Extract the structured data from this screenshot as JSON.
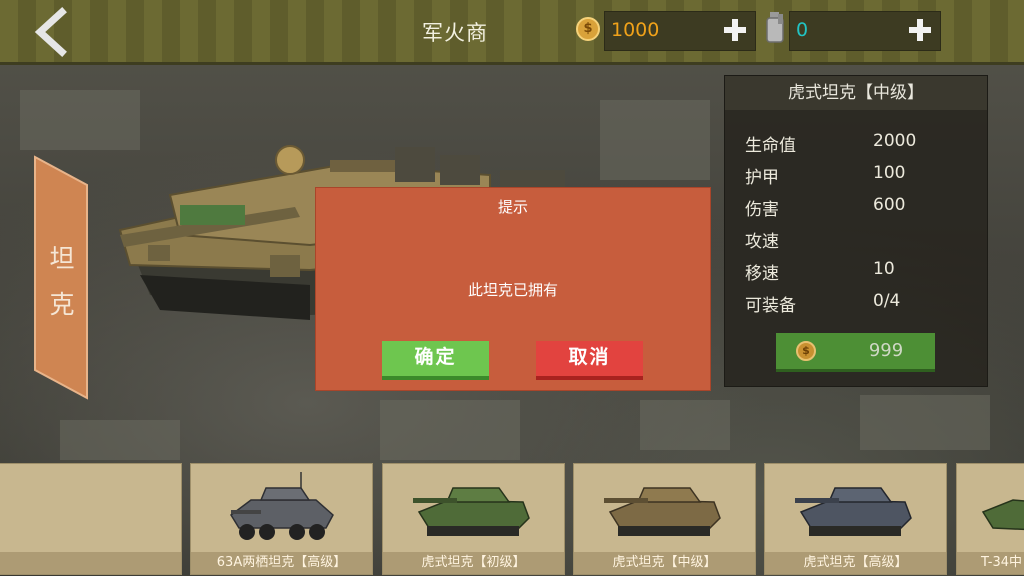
{
  "header": {
    "title": "军火商",
    "coins": "1000",
    "ammo": "0",
    "coin_symbol": "$"
  },
  "side_tab": {
    "label": "坦克"
  },
  "stats": {
    "title": "虎式坦克【中级】",
    "rows": [
      {
        "key": "生命值",
        "value": "2000"
      },
      {
        "key": "护甲",
        "value": "100"
      },
      {
        "key": "伤害",
        "value": "600"
      },
      {
        "key": "攻速",
        "value": ""
      },
      {
        "key": "移速",
        "value": "10"
      },
      {
        "key": "可装备",
        "value": "0/4"
      }
    ],
    "price": "999"
  },
  "dialog": {
    "title": "提示",
    "message": "此坦克已拥有",
    "confirm_label": "确定",
    "cancel_label": "取消"
  },
  "vehicles": [
    {
      "label": "63A两栖坦克【高级】",
      "hull_color": "#5d6066"
    },
    {
      "label": "虎式坦克【初级】",
      "hull_color": "#4f6b38"
    },
    {
      "label": "虎式坦克【中级】",
      "hull_color": "#7d6a45"
    },
    {
      "label": "虎式坦克【高级】",
      "hull_color": "#4e5562"
    },
    {
      "label": "T-34中",
      "hull_color": "#4f6b38"
    }
  ],
  "colors": {
    "accent_green": "#6ec64f",
    "cancel_red": "#e2433f",
    "dialog_bg": "#c75d3d",
    "coin_text": "#f0a21a",
    "ammo_text": "#22c4c4"
  }
}
